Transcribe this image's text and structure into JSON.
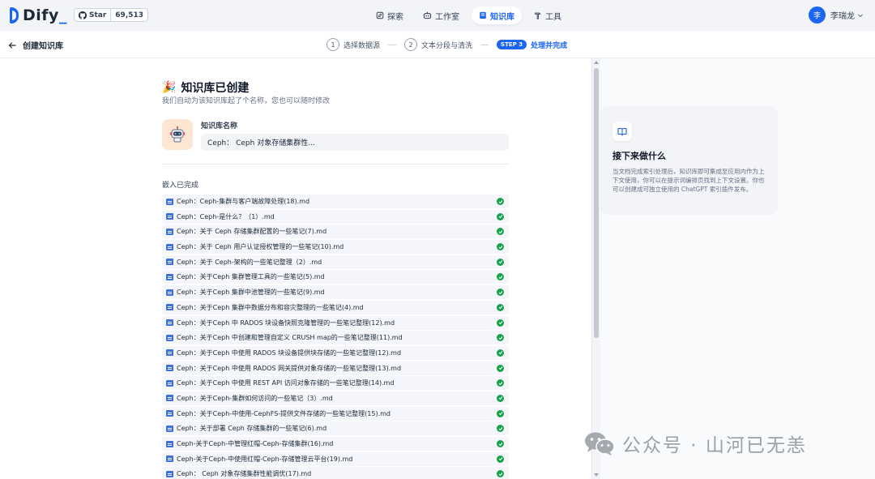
{
  "app": {
    "logo_text": "Dify",
    "github_star_label": "Star",
    "github_star_count": "69,513"
  },
  "nav": {
    "items": [
      {
        "label": "探索",
        "icon": "compass-icon",
        "active": false
      },
      {
        "label": "工作室",
        "icon": "robot-icon",
        "active": false
      },
      {
        "label": "知识库",
        "icon": "book-icon",
        "active": true
      },
      {
        "label": "工具",
        "icon": "hammer-icon",
        "active": false
      }
    ]
  },
  "user": {
    "avatar_initial": "李",
    "name": "李瑞龙"
  },
  "subheader": {
    "back_label": "创建知识库",
    "steps": [
      {
        "num": "1",
        "label": "选择数据源"
      },
      {
        "num": "2",
        "label": "文本分段与清洗"
      },
      {
        "badge": "STEP 3",
        "label": "处理并完成"
      }
    ]
  },
  "main": {
    "title_emoji": "🎉",
    "title": "知识库已创建",
    "subtitle": "我们自动为该知识库起了个名称，您也可以随时修改",
    "kb_name_label": "知识库名称",
    "kb_name_value": "Ceph： Ceph 对象存储集群性...",
    "embed_status": "嵌入已完成",
    "files": [
      "Ceph：Ceph-集群与客户端故障处理(18).md",
      "Ceph：Ceph-是什么？（1）.md",
      "Ceph：关于 Ceph 存储集群配置的一些笔记(7).md",
      "Ceph：关于 Ceph 用户认证授权管理的一些笔记(10).md",
      "Ceph：关于 Ceph-架构的一些笔记整理（2）.md",
      "Ceph：关于Ceph 集群管理工具的一些笔记(5).md",
      "Ceph：关于Ceph 集群中池管理的一些笔记(9).md",
      "Ceph：关于Ceph 集群中数据分布和容灾整理的一些笔记(4).md",
      "Ceph：关于Ceph 中 RADOS 块设备快照克隆管理的一些笔记整理(12).md",
      "Ceph：关于Ceph 中创建和管理自定义 CRUSH map的一些笔记整理(11).md",
      "Ceph：关于Ceph 中使用 RADOS 块设备提供块存储的一些笔记整理(12).md",
      "Ceph：关于Ceph 中使用 RADOS 网关提供对象存储的一些笔记整理(13).md",
      "Ceph：关于Ceph 中使用 REST API 访问对象存储的一些笔记整理(14).md",
      "Ceph：关于Ceph-集群如何访问的一些笔记（3）.md",
      "Ceph：关于Ceph-中使用-CephFS-提供文件存储的一些笔记整理(15).md",
      "Ceph：关于部署 Ceph 存储集群的一些笔记(6).md",
      "Ceph-关于Ceph-中管理红帽-Ceph-存储集群(16).md",
      "Ceph-关于Ceph-中使用红帽-Ceph-存储管理云平台(19).md",
      "Ceph： Ceph 对象存储集群性能调优(17).md"
    ]
  },
  "next_card": {
    "title": "接下来做什么",
    "description": "当文档完成索引处理后，知识库即可集成至应用内作为上下文使用，你可以在提示词编排页找到上下文设置。你也可以创建成可独立使用的 ChatGPT 索引插件发布。"
  },
  "watermark": {
    "text": "公众号 · 山河已无恙"
  },
  "colors": {
    "accent": "#1c64f2",
    "success": "#16a34a",
    "topbar_bg": "#f2f4f7"
  }
}
